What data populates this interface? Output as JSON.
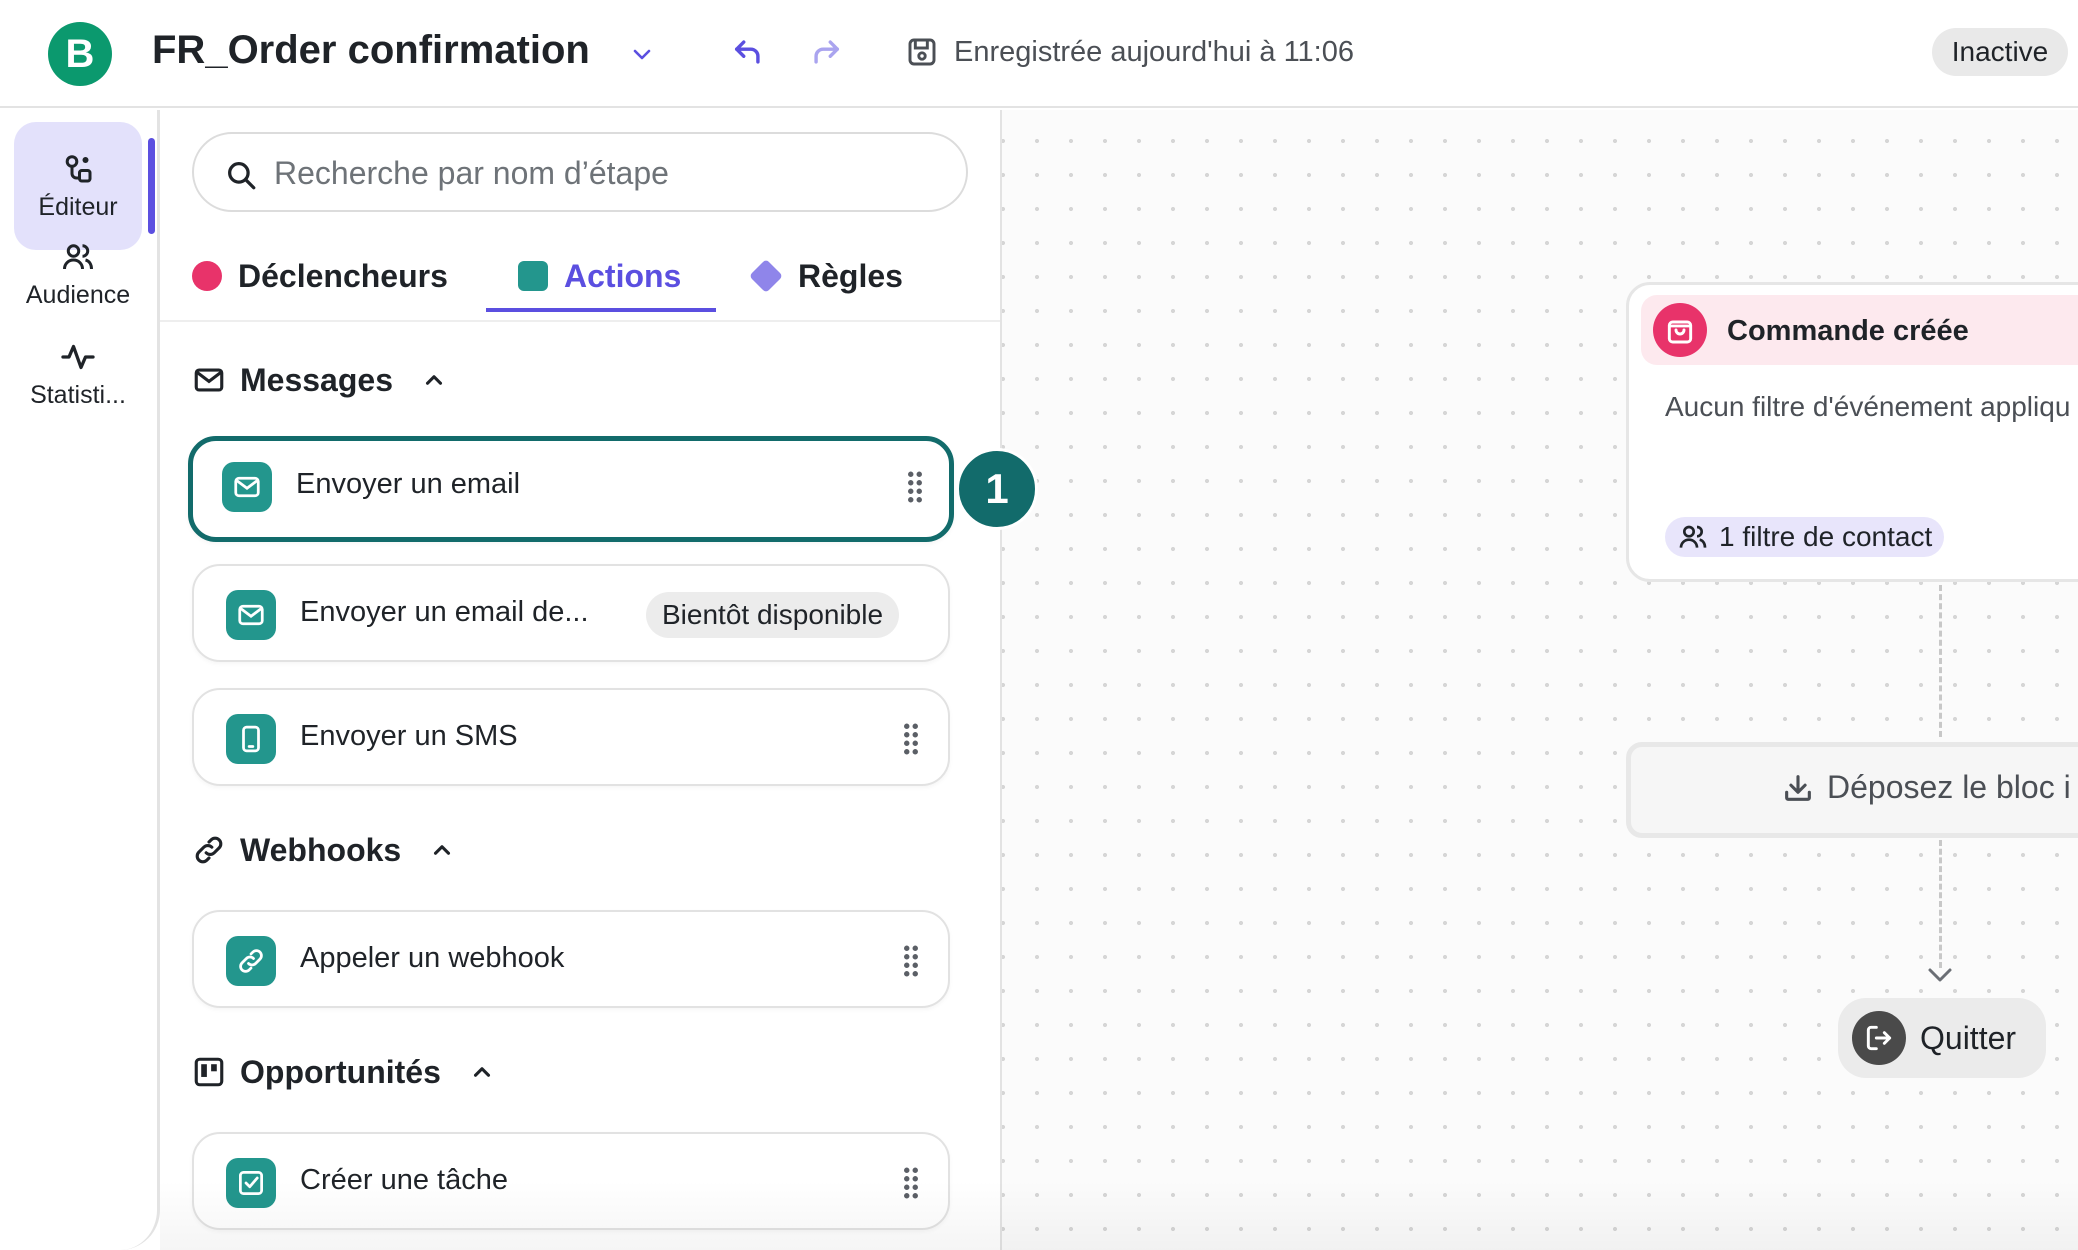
{
  "header": {
    "logo_letter": "B",
    "title": "FR_Order confirmation",
    "saved_text": "Enregistrée aujourd'hui à 11:06",
    "status": "Inactive"
  },
  "rail": {
    "items": [
      {
        "label": "Éditeur",
        "icon": "editor-icon",
        "active": true
      },
      {
        "label": "Audience",
        "icon": "users-icon",
        "active": false
      },
      {
        "label": "Statisti...",
        "icon": "activity-icon",
        "active": false
      }
    ]
  },
  "panel": {
    "search_placeholder": "Recherche par nom d’étape",
    "tabs": [
      {
        "label": "Déclencheurs",
        "color": "#e8336a"
      },
      {
        "label": "Actions",
        "color": "#23968d",
        "active": true
      },
      {
        "label": "Règles",
        "color": "#8f85ea"
      }
    ],
    "sections": [
      {
        "title": "Messages",
        "icon": "envelope-icon",
        "items": [
          {
            "label": "Envoyer un email",
            "icon": "mail-icon",
            "selected": true
          },
          {
            "label": "Envoyer un email de...",
            "icon": "mail-icon",
            "badge": "Bientôt disponible"
          },
          {
            "label": "Envoyer un SMS",
            "icon": "phone-icon"
          }
        ]
      },
      {
        "title": "Webhooks",
        "icon": "link-icon",
        "items": [
          {
            "label": "Appeler un webhook",
            "icon": "link-icon"
          }
        ]
      },
      {
        "title": "Opportunités",
        "icon": "board-icon",
        "items": [
          {
            "label": "Créer une tâche",
            "icon": "checkbox-icon"
          }
        ]
      }
    ],
    "step_marker": "1"
  },
  "canvas": {
    "trigger": {
      "title": "Commande créée",
      "subtitle": "Aucun filtre d'événement appliqu",
      "contact_filter": "1 filtre de contact"
    },
    "drop_zone": "Déposez le bloc i",
    "exit": "Quitter"
  },
  "colors": {
    "brand": "#0b996e",
    "accent": "#5b4fe0",
    "action": "#23968d",
    "trigger": "#e8336a",
    "selected_border": "#126b6b"
  }
}
